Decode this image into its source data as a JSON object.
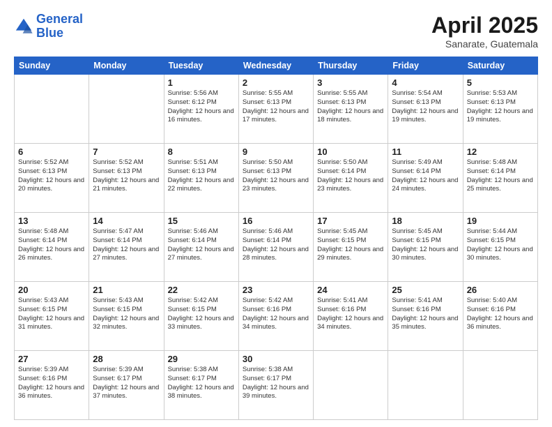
{
  "logo": {
    "line1": "General",
    "line2": "Blue"
  },
  "title": "April 2025",
  "subtitle": "Sanarate, Guatemala",
  "days_of_week": [
    "Sunday",
    "Monday",
    "Tuesday",
    "Wednesday",
    "Thursday",
    "Friday",
    "Saturday"
  ],
  "weeks": [
    [
      {
        "day": "",
        "sunrise": "",
        "sunset": "",
        "daylight": ""
      },
      {
        "day": "",
        "sunrise": "",
        "sunset": "",
        "daylight": ""
      },
      {
        "day": "1",
        "sunrise": "Sunrise: 5:56 AM",
        "sunset": "Sunset: 6:12 PM",
        "daylight": "Daylight: 12 hours and 16 minutes."
      },
      {
        "day": "2",
        "sunrise": "Sunrise: 5:55 AM",
        "sunset": "Sunset: 6:13 PM",
        "daylight": "Daylight: 12 hours and 17 minutes."
      },
      {
        "day": "3",
        "sunrise": "Sunrise: 5:55 AM",
        "sunset": "Sunset: 6:13 PM",
        "daylight": "Daylight: 12 hours and 18 minutes."
      },
      {
        "day": "4",
        "sunrise": "Sunrise: 5:54 AM",
        "sunset": "Sunset: 6:13 PM",
        "daylight": "Daylight: 12 hours and 19 minutes."
      },
      {
        "day": "5",
        "sunrise": "Sunrise: 5:53 AM",
        "sunset": "Sunset: 6:13 PM",
        "daylight": "Daylight: 12 hours and 19 minutes."
      }
    ],
    [
      {
        "day": "6",
        "sunrise": "Sunrise: 5:52 AM",
        "sunset": "Sunset: 6:13 PM",
        "daylight": "Daylight: 12 hours and 20 minutes."
      },
      {
        "day": "7",
        "sunrise": "Sunrise: 5:52 AM",
        "sunset": "Sunset: 6:13 PM",
        "daylight": "Daylight: 12 hours and 21 minutes."
      },
      {
        "day": "8",
        "sunrise": "Sunrise: 5:51 AM",
        "sunset": "Sunset: 6:13 PM",
        "daylight": "Daylight: 12 hours and 22 minutes."
      },
      {
        "day": "9",
        "sunrise": "Sunrise: 5:50 AM",
        "sunset": "Sunset: 6:13 PM",
        "daylight": "Daylight: 12 hours and 23 minutes."
      },
      {
        "day": "10",
        "sunrise": "Sunrise: 5:50 AM",
        "sunset": "Sunset: 6:14 PM",
        "daylight": "Daylight: 12 hours and 23 minutes."
      },
      {
        "day": "11",
        "sunrise": "Sunrise: 5:49 AM",
        "sunset": "Sunset: 6:14 PM",
        "daylight": "Daylight: 12 hours and 24 minutes."
      },
      {
        "day": "12",
        "sunrise": "Sunrise: 5:48 AM",
        "sunset": "Sunset: 6:14 PM",
        "daylight": "Daylight: 12 hours and 25 minutes."
      }
    ],
    [
      {
        "day": "13",
        "sunrise": "Sunrise: 5:48 AM",
        "sunset": "Sunset: 6:14 PM",
        "daylight": "Daylight: 12 hours and 26 minutes."
      },
      {
        "day": "14",
        "sunrise": "Sunrise: 5:47 AM",
        "sunset": "Sunset: 6:14 PM",
        "daylight": "Daylight: 12 hours and 27 minutes."
      },
      {
        "day": "15",
        "sunrise": "Sunrise: 5:46 AM",
        "sunset": "Sunset: 6:14 PM",
        "daylight": "Daylight: 12 hours and 27 minutes."
      },
      {
        "day": "16",
        "sunrise": "Sunrise: 5:46 AM",
        "sunset": "Sunset: 6:14 PM",
        "daylight": "Daylight: 12 hours and 28 minutes."
      },
      {
        "day": "17",
        "sunrise": "Sunrise: 5:45 AM",
        "sunset": "Sunset: 6:15 PM",
        "daylight": "Daylight: 12 hours and 29 minutes."
      },
      {
        "day": "18",
        "sunrise": "Sunrise: 5:45 AM",
        "sunset": "Sunset: 6:15 PM",
        "daylight": "Daylight: 12 hours and 30 minutes."
      },
      {
        "day": "19",
        "sunrise": "Sunrise: 5:44 AM",
        "sunset": "Sunset: 6:15 PM",
        "daylight": "Daylight: 12 hours and 30 minutes."
      }
    ],
    [
      {
        "day": "20",
        "sunrise": "Sunrise: 5:43 AM",
        "sunset": "Sunset: 6:15 PM",
        "daylight": "Daylight: 12 hours and 31 minutes."
      },
      {
        "day": "21",
        "sunrise": "Sunrise: 5:43 AM",
        "sunset": "Sunset: 6:15 PM",
        "daylight": "Daylight: 12 hours and 32 minutes."
      },
      {
        "day": "22",
        "sunrise": "Sunrise: 5:42 AM",
        "sunset": "Sunset: 6:15 PM",
        "daylight": "Daylight: 12 hours and 33 minutes."
      },
      {
        "day": "23",
        "sunrise": "Sunrise: 5:42 AM",
        "sunset": "Sunset: 6:16 PM",
        "daylight": "Daylight: 12 hours and 34 minutes."
      },
      {
        "day": "24",
        "sunrise": "Sunrise: 5:41 AM",
        "sunset": "Sunset: 6:16 PM",
        "daylight": "Daylight: 12 hours and 34 minutes."
      },
      {
        "day": "25",
        "sunrise": "Sunrise: 5:41 AM",
        "sunset": "Sunset: 6:16 PM",
        "daylight": "Daylight: 12 hours and 35 minutes."
      },
      {
        "day": "26",
        "sunrise": "Sunrise: 5:40 AM",
        "sunset": "Sunset: 6:16 PM",
        "daylight": "Daylight: 12 hours and 36 minutes."
      }
    ],
    [
      {
        "day": "27",
        "sunrise": "Sunrise: 5:39 AM",
        "sunset": "Sunset: 6:16 PM",
        "daylight": "Daylight: 12 hours and 36 minutes."
      },
      {
        "day": "28",
        "sunrise": "Sunrise: 5:39 AM",
        "sunset": "Sunset: 6:17 PM",
        "daylight": "Daylight: 12 hours and 37 minutes."
      },
      {
        "day": "29",
        "sunrise": "Sunrise: 5:38 AM",
        "sunset": "Sunset: 6:17 PM",
        "daylight": "Daylight: 12 hours and 38 minutes."
      },
      {
        "day": "30",
        "sunrise": "Sunrise: 5:38 AM",
        "sunset": "Sunset: 6:17 PM",
        "daylight": "Daylight: 12 hours and 39 minutes."
      },
      {
        "day": "",
        "sunrise": "",
        "sunset": "",
        "daylight": ""
      },
      {
        "day": "",
        "sunrise": "",
        "sunset": "",
        "daylight": ""
      },
      {
        "day": "",
        "sunrise": "",
        "sunset": "",
        "daylight": ""
      }
    ]
  ]
}
